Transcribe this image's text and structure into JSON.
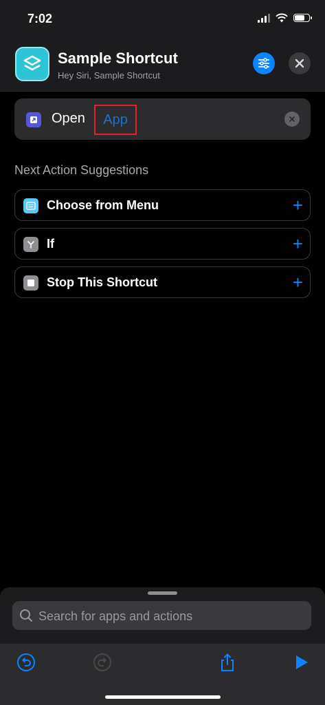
{
  "status": {
    "time": "7:02"
  },
  "header": {
    "title": "Sample Shortcut",
    "subtitle": "Hey Siri, Sample Shortcut"
  },
  "action": {
    "verb": "Open",
    "parameter": "App"
  },
  "suggestions": {
    "title": "Next Action Suggestions",
    "items": [
      {
        "label": "Choose from Menu",
        "icon": "menu-icon",
        "color": "#5ac8fa"
      },
      {
        "label": "If",
        "icon": "branch-icon",
        "color": "#8e8e93"
      },
      {
        "label": "Stop This Shortcut",
        "icon": "stop-icon",
        "color": "#8e8e93"
      }
    ]
  },
  "search": {
    "placeholder": "Search for apps and actions"
  },
  "colors": {
    "accent": "#0a84ff",
    "highlight": "#e0242d",
    "app_icon": "#2ec4d6"
  }
}
